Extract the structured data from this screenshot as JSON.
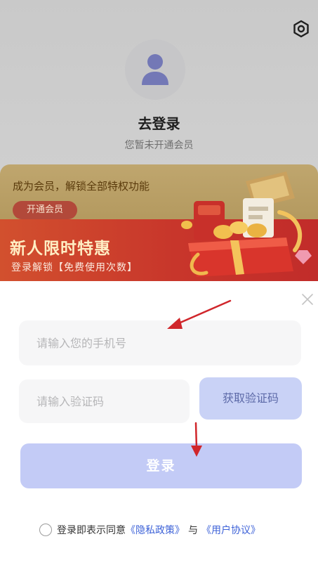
{
  "profile": {
    "title": "去登录",
    "subtitle": "您暂未开通会员",
    "settings_icon": "gear-icon",
    "avatar_icon": "user-avatar-icon"
  },
  "vip_card": {
    "text": "成为会员，解锁全部特权功能",
    "button_label": "开通会员"
  },
  "promo": {
    "title": "新人限时特惠",
    "subtitle": "登录解锁【免费使用次数】"
  },
  "login_sheet": {
    "close_icon": "close-icon",
    "phone_placeholder": "请输入您的手机号",
    "code_placeholder": "请输入验证码",
    "get_code_label": "获取验证码",
    "login_label": "登录",
    "agreement_prefix": "登录即表示同意",
    "privacy_link": "《隐私政策》",
    "conjunction": "与",
    "user_agreement_link": "《用户协议》"
  },
  "colors": {
    "accent_link": "#3d62d8",
    "login_button": "#c3cbf6",
    "get_code_button": "#c9d2f6",
    "promo_red": "#c8362b",
    "annotation_arrow": "#d0262b"
  }
}
